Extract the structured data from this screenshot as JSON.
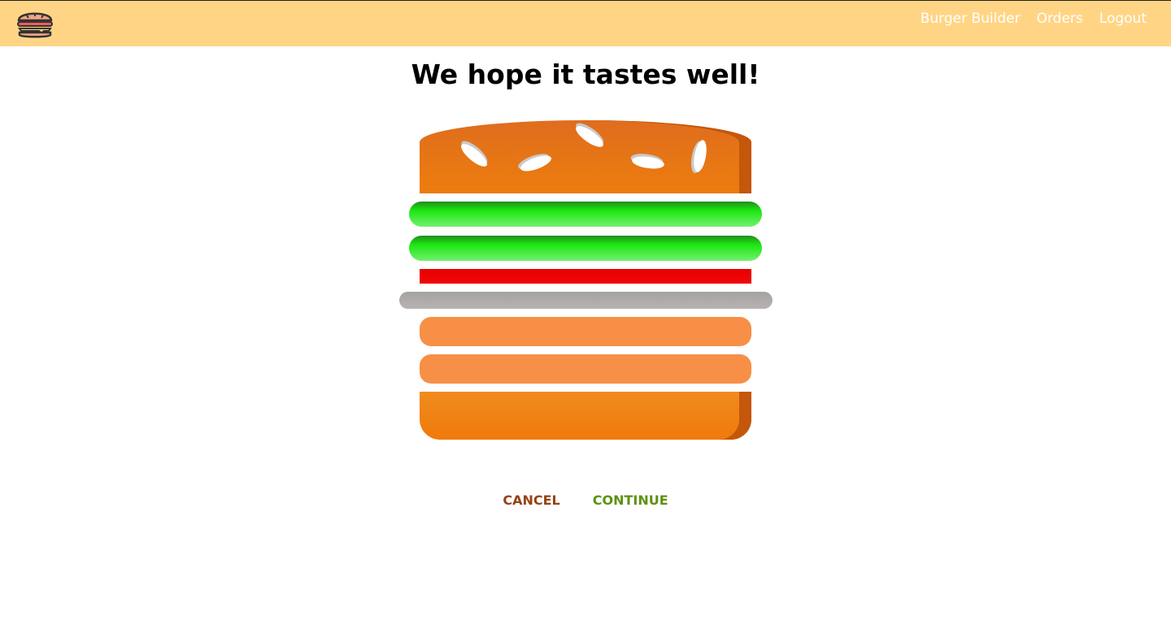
{
  "toolbar": {
    "nav": [
      {
        "label": "Burger Builder"
      },
      {
        "label": "Orders"
      },
      {
        "label": "Logout"
      }
    ]
  },
  "checkout": {
    "title": "We hope it tastes well!",
    "ingredients": [
      "bread-top",
      "salad",
      "salad",
      "bacon",
      "cheese",
      "meat",
      "meat",
      "bread-bottom"
    ],
    "cancel_label": "CANCEL",
    "continue_label": "CONTINUE"
  },
  "colors": {
    "toolbar_bg": "#ffd585",
    "cancel": "#944317",
    "continue": "#5c9210"
  }
}
